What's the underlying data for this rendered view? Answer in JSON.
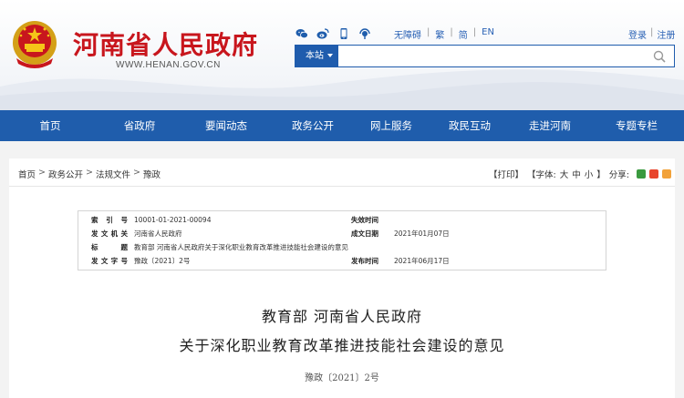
{
  "header": {
    "site_title": "河南省人民政府",
    "site_url": "WWW.HENAN.GOV.CN",
    "social_icons": [
      "wechat-icon",
      "weibo-icon",
      "mobile-icon",
      "podcast-icon"
    ],
    "top_links": [
      "无障碍",
      "繁",
      "简",
      "EN"
    ],
    "login": {
      "login_label": "登录",
      "register_label": "注册"
    },
    "search": {
      "scope_label": "本站",
      "value": "",
      "placeholder": ""
    }
  },
  "nav": {
    "items": [
      "首页",
      "省政府",
      "要闻动态",
      "政务公开",
      "网上服务",
      "政民互动",
      "走进河南",
      "专题专栏"
    ]
  },
  "breadcrumb": [
    "首页",
    "政务公开",
    "法规文件",
    "豫政"
  ],
  "tools": {
    "print": "【打印】",
    "font_label": "【字体:",
    "font_large": "大",
    "font_medium": "中",
    "font_small": "小",
    "font_end": "】",
    "share_label": "分享:"
  },
  "info": {
    "index_label": "索 引 号",
    "index_value": "10001-01-2021-00094",
    "effective_label": "失效时间",
    "effective_value": "",
    "issuer_label": "发文机关",
    "issuer_value": "河南省人民政府",
    "written_label": "成文日期",
    "written_value": "2021年01月07日",
    "title_label": "标 题",
    "title_value": "教育部 河南省人民政府关于深化职业教育改革推进技能社会建设的意见",
    "docno_label": "发文字号",
    "docno_value": "豫政〔2021〕2号",
    "publish_label": "发布时间",
    "publish_value": "2021年06月17日"
  },
  "document": {
    "title_line1": "教育部 河南省人民政府",
    "title_line2": "关于深化职业教育改革推进技能社会建设的意见",
    "doc_number": "豫政〔2021〕2号"
  },
  "colors": {
    "brand_red": "#c8161d",
    "nav_blue": "#1f5dac",
    "link_blue": "#2a62b5"
  }
}
